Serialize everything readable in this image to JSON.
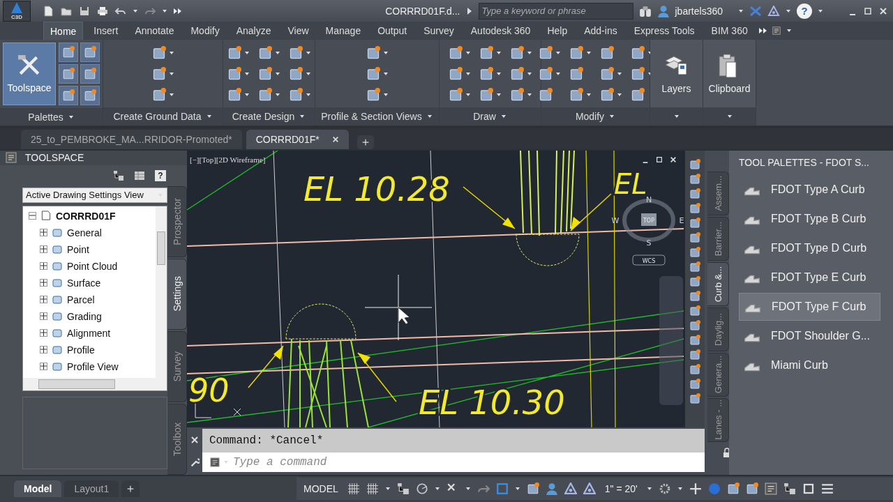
{
  "title_bar": {
    "app_badge": "C3D",
    "title": "CORRRD01F.d...",
    "search": {
      "placeholder": "Type a keyword or phrase"
    },
    "user": "jbartels360",
    "help": "?"
  },
  "ribbon_tabs": [
    {
      "label": "Home",
      "selected": true
    },
    {
      "label": "Insert",
      "selected": false
    },
    {
      "label": "Annotate",
      "selected": false
    },
    {
      "label": "Modify",
      "selected": false
    },
    {
      "label": "Analyze",
      "selected": false
    },
    {
      "label": "View",
      "selected": false
    },
    {
      "label": "Manage",
      "selected": false
    },
    {
      "label": "Output",
      "selected": false
    },
    {
      "label": "Survey",
      "selected": false
    },
    {
      "label": "Autodesk 360",
      "selected": false
    },
    {
      "label": "Help",
      "selected": false
    },
    {
      "label": "Add-ins",
      "selected": false
    },
    {
      "label": "Express Tools",
      "selected": false
    },
    {
      "label": "BIM 360",
      "selected": false
    }
  ],
  "ribbon_panels": [
    {
      "kind": "launcher",
      "title": "Palettes",
      "button": "Toolspace"
    },
    {
      "kind": "grid",
      "title": "Create Ground Data"
    },
    {
      "kind": "grid",
      "title": "Create Design"
    },
    {
      "kind": "grid",
      "title": "Profile & Section Views"
    },
    {
      "kind": "grid",
      "title": "Draw"
    },
    {
      "kind": "grid",
      "title": "Modify"
    },
    {
      "kind": "large",
      "button": "Layers"
    },
    {
      "kind": "large",
      "button": "Clipboard"
    }
  ],
  "file_tabs": [
    {
      "label": "25_to_PEMBROKE_MA...RRIDOR-Promoted*",
      "selected": false
    },
    {
      "label": "CORRRD01F*",
      "selected": true
    }
  ],
  "toolspace": {
    "title": "TOOLSPACE",
    "view": "Active Drawing Settings View",
    "tree": {
      "label": "CORRRD01F",
      "expanded": true,
      "children": [
        {
          "label": "General",
          "expanded": false
        },
        {
          "label": "Point",
          "expanded": false
        },
        {
          "label": "Point Cloud",
          "expanded": false
        },
        {
          "label": "Surface",
          "expanded": false
        },
        {
          "label": "Parcel",
          "expanded": false
        },
        {
          "label": "Grading",
          "expanded": false
        },
        {
          "label": "Alignment",
          "expanded": false
        },
        {
          "label": "Profile",
          "expanded": false
        },
        {
          "label": "Profile View",
          "expanded": false
        }
      ]
    },
    "side_tabs": [
      {
        "label": "Prospector",
        "selected": false
      },
      {
        "label": "Settings",
        "selected": true
      },
      {
        "label": "Survey",
        "selected": false
      },
      {
        "label": "Toolbox",
        "selected": false
      }
    ]
  },
  "viewport": {
    "label": "[−][Top][2D Wireframe]",
    "annotations": [
      "EL 10.28",
      "EL",
      "90",
      "EL 10.30"
    ],
    "viewcube": {
      "north": "N",
      "south": "S",
      "west": "W",
      "east": "E",
      "face": "TOP",
      "ucs": "WCS"
    }
  },
  "command_line": {
    "history": "Command: *Cancel*",
    "placeholder": "Type a command"
  },
  "tool_palette": {
    "title": "TOOL PALETTES - FDOT S...",
    "tabs": [
      {
        "label": "Assem...",
        "selected": false
      },
      {
        "label": "Barrier...",
        "selected": false
      },
      {
        "label": "Curb &...",
        "selected": true
      },
      {
        "label": "Daylig...",
        "selected": false
      },
      {
        "label": "Genera...",
        "selected": false
      },
      {
        "label": "Lanes - ...",
        "selected": false
      }
    ],
    "items": [
      {
        "label": "FDOT Type A Curb",
        "selected": false
      },
      {
        "label": "FDOT Type B Curb",
        "selected": false
      },
      {
        "label": "FDOT Type D Curb",
        "selected": false
      },
      {
        "label": "FDOT Type E Curb",
        "selected": false
      },
      {
        "label": "FDOT Type F Curb",
        "selected": true
      },
      {
        "label": "FDOT  Shoulder G...",
        "selected": false
      },
      {
        "label": "Miami Curb",
        "selected": false
      }
    ]
  },
  "layout_tabs": [
    {
      "label": "Model",
      "selected": true
    },
    {
      "label": "Layout1",
      "selected": false
    }
  ],
  "status_bar": {
    "space": "MODEL",
    "scale": "1\" = 20'"
  }
}
